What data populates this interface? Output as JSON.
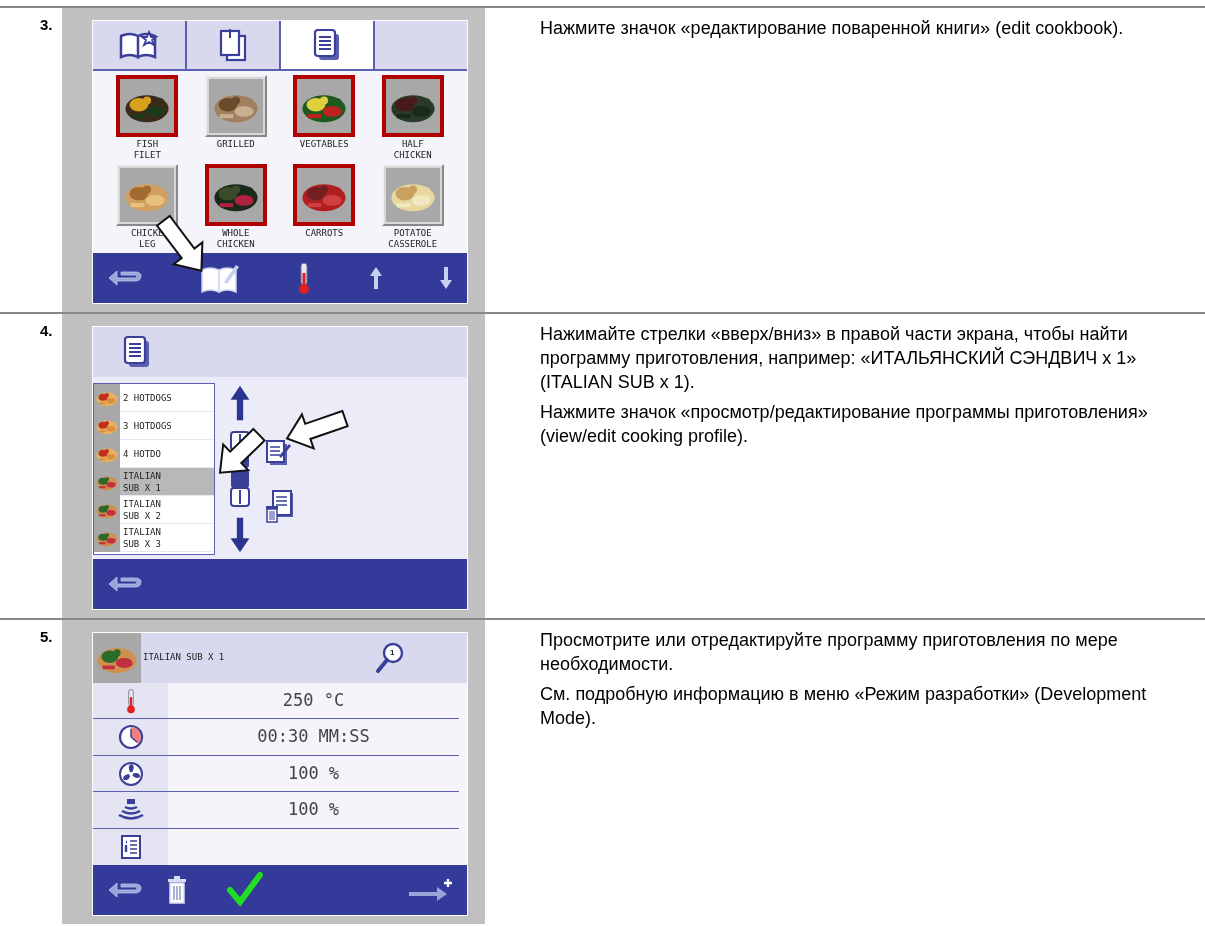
{
  "steps": [
    {
      "number": "3.",
      "screen": {
        "kind": "cookbook",
        "tabs": [
          {
            "selected": false
          },
          {
            "selected": false
          },
          {
            "selected": true
          },
          {
            "selected": false
          }
        ],
        "tiles": [
          {
            "label": "FISH\nFILET",
            "outlined": true
          },
          {
            "label": "GRILLED",
            "outlined": false
          },
          {
            "label": "VEGTABLES",
            "outlined": true
          },
          {
            "label": "HALF\nCHICKEN",
            "outlined": true
          },
          {
            "label": "CHICKE\nLEG",
            "outlined": false
          },
          {
            "label": "WHOLE\nCHICKEN",
            "outlined": true
          },
          {
            "label": "CARROTS",
            "outlined": true
          },
          {
            "label": "POTATOE\nCASSEROLE",
            "outlined": false
          }
        ]
      },
      "paragraphs": [
        "Нажмите значок «редактирование поваренной книги» (edit cookbook)."
      ]
    },
    {
      "number": "4.",
      "screen": {
        "kind": "profile_list",
        "items": [
          {
            "label": "2 HOTDOGS",
            "selected": false
          },
          {
            "label": "3 HOTDOGS",
            "selected": false
          },
          {
            "label": "4 HOTDO",
            "selected": false
          },
          {
            "label": "ITALIAN\nSUB X 1",
            "selected": true
          },
          {
            "label": "ITALIAN\nSUB X 2",
            "selected": false
          },
          {
            "label": "ITALIAN\nSUB X 3",
            "selected": false
          }
        ]
      },
      "paragraphs": [
        "Нажимайте стрелки «вверх/вниз» в правой части экрана, чтобы найти программу приготовления, например: «ИТАЛЬЯНСКИЙ СЭНДВИЧ x 1» (ITALIAN SUB x 1).",
        "Нажмите значок «просмотр/редактирование программы приготовления» (view/edit cooking profile)."
      ]
    },
    {
      "number": "5.",
      "screen": {
        "kind": "profile_detail",
        "title": "ITALIAN SUB X 1",
        "step_badge": "1",
        "settings": [
          {
            "kind": "temperature",
            "value": "250 °C"
          },
          {
            "kind": "time",
            "value": "00:30 MM:SS"
          },
          {
            "kind": "fan",
            "value": "100 %"
          },
          {
            "kind": "microwave",
            "value": "100 %"
          },
          {
            "kind": "info"
          }
        ]
      },
      "paragraphs": [
        "Просмотрите или отредактируйте программу приготовления по мере необходимости.",
        "См. подробную информацию в меню «Режим разработки» (Development Mode)."
      ]
    }
  ]
}
